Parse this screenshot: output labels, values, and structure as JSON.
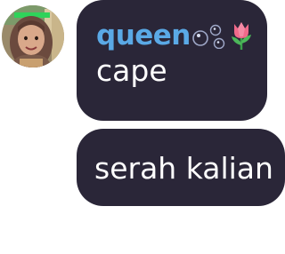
{
  "messages": [
    {
      "sender": "queen",
      "sender_decorations": [
        "bubbles-icon",
        "tulip-icon"
      ],
      "text": "cape"
    },
    {
      "text": "serah kalian"
    }
  ],
  "colors": {
    "bubble_bg": "#2a2638",
    "sender_name": "#5aa9e6",
    "message_text": "#ffffff",
    "page_bg": "#ffffff"
  }
}
